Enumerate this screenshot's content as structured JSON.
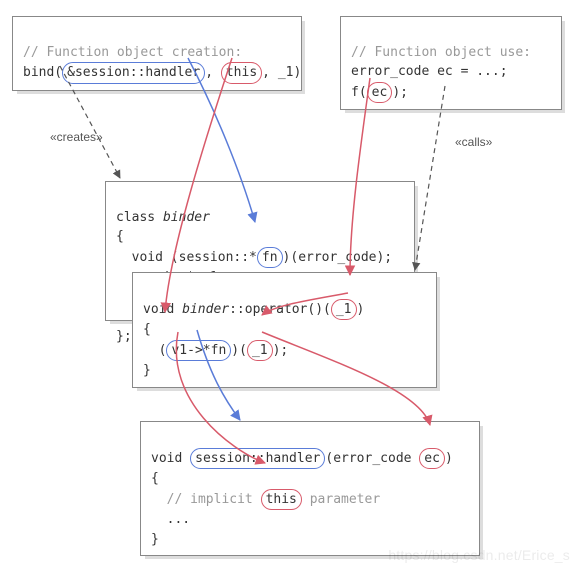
{
  "box_creation": {
    "comment": "// Function object creation:",
    "bind_word": "bind(",
    "ring_handler": "&session::handler",
    "sep1": ", ",
    "ring_this": "this",
    "sep2": ", _1)"
  },
  "box_use": {
    "comment": "// Function object use:",
    "line1": "error_code ec = ...;",
    "line2a": "f(",
    "ring_ec": "ec",
    "line2b": ");"
  },
  "label_creates": "«creates»",
  "label_calls": "«calls»",
  "box_binder": {
    "line1a": "class ",
    "line1b": "binder",
    "line2": "{",
    "line3a": "  void (session::*",
    "ring_fn": "fn",
    "line3b": ")(error_code);",
    "line4": "  session* v1;",
    "line5": "};"
  },
  "box_operator": {
    "line1a": "void ",
    "line1b": "binder",
    "line1c": "::operator()(",
    "ring_arg1": "_1",
    "line1d": ")",
    "line2": "{",
    "line3a": "  (",
    "ring_v1fn": "v1->*fn",
    "line3b": ")(",
    "ring_call1": "_1",
    "line3c": ");",
    "line4": "}"
  },
  "box_handler": {
    "line1a": "void ",
    "ring_sig": "session::handler",
    "line1b": "(error_code ",
    "ring_ec": "ec",
    "line1c": ")",
    "line2": "{",
    "line3a": "  // implicit ",
    "ring_this": "this",
    "line3b": " parameter",
    "line4": "  ...",
    "line5": "}"
  },
  "watermark": "https://blog.csdn.net/Erice_s"
}
